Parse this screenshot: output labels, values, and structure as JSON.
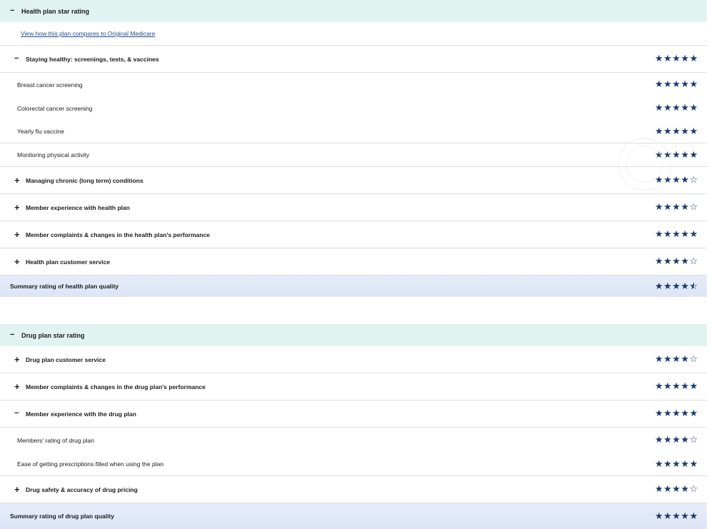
{
  "health": {
    "header": "Health plan star rating",
    "compare_link": "View how this plan compares to Original Medicare",
    "groups": [
      {
        "label": "Staying healthy: screenings, tests, & vaccines",
        "toggle": "−",
        "stars": "★★★★★"
      },
      {
        "label": "Managing chronic (long term) conditions",
        "toggle": "+",
        "stars": "★★★★☆"
      },
      {
        "label": "Member experience with health plan",
        "toggle": "+",
        "stars": "★★★★☆"
      },
      {
        "label": "Member complaints & changes in the health plan's performance",
        "toggle": "+",
        "stars": "★★★★★"
      },
      {
        "label": "Health plan customer service",
        "toggle": "+",
        "stars": "★★★★☆"
      }
    ],
    "items": [
      {
        "label": "Breast cancer screening",
        "stars": "★★★★★"
      },
      {
        "label": "Colorectal cancer screening",
        "stars": "★★★★★"
      },
      {
        "label": "Yearly flu vaccine",
        "stars": "★★★★★"
      },
      {
        "label": "Monitoring physical activity",
        "stars": "★★★★★"
      }
    ],
    "summary": {
      "label": "Summary rating of health plan quality",
      "stars": "★★★★",
      "half": "☆",
      "rating": 4.5
    }
  },
  "drug": {
    "header": "Drug plan star rating",
    "groups": [
      {
        "label": "Drug plan customer service",
        "toggle": "+",
        "stars": "★★★★☆"
      },
      {
        "label": "Member complaints & changes in the drug plan's performance",
        "toggle": "+",
        "stars": "★★★★★"
      },
      {
        "label": "Member experience with the drug plan",
        "toggle": "−",
        "stars": "★★★★★"
      },
      {
        "label": "Drug safety & accuracy of drug pricing",
        "toggle": "+",
        "stars": "★★★★☆"
      }
    ],
    "items": [
      {
        "label": "Members' rating of drug plan",
        "stars": "★★★★☆"
      },
      {
        "label": "Ease of getting prescriptions filled when using the plan",
        "stars": "★★★★★"
      }
    ],
    "summary": {
      "label": "Summary rating of drug plan quality",
      "stars": "★★★★★"
    }
  },
  "colors": {
    "header_bg": "#e1f3f1",
    "summary_bg": "#e2e9f8",
    "star": "#1b3a6b",
    "link": "#1d4f91"
  },
  "icons": {
    "collapse": "minus-icon",
    "expand": "plus-icon",
    "star": "star-icon"
  }
}
